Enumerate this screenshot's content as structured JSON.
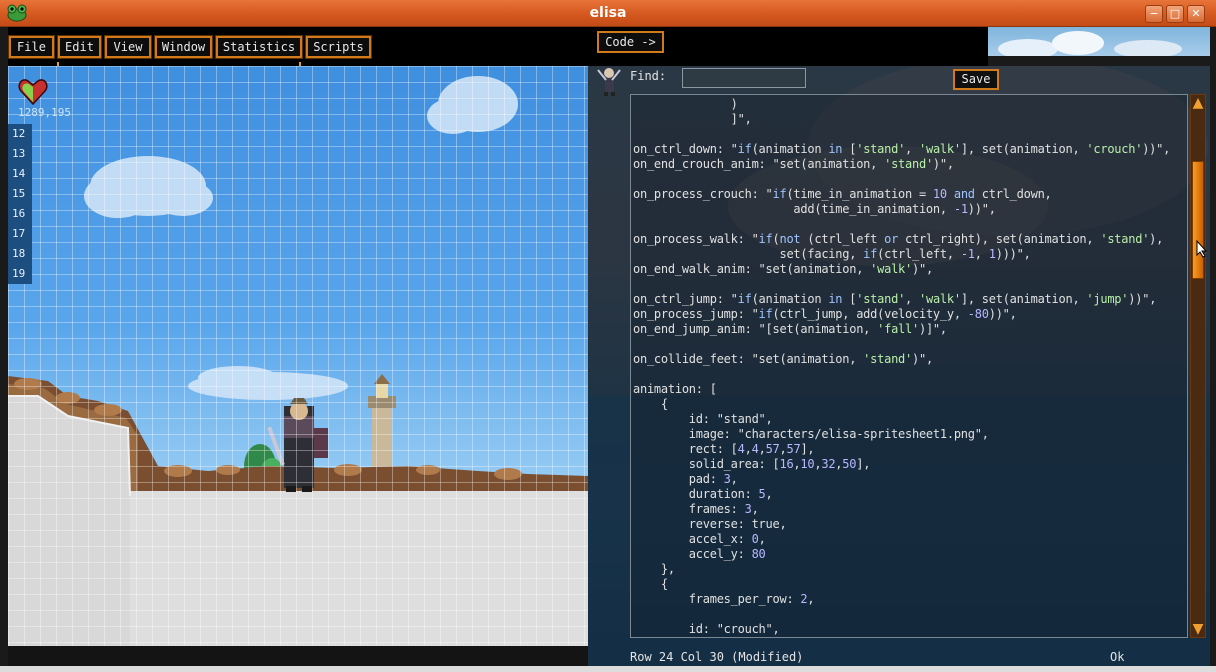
{
  "window": {
    "title": "elisa",
    "controls": {
      "minimize": "−",
      "maximize": "□",
      "close": "✕"
    }
  },
  "menu": {
    "items": [
      "File",
      "Edit",
      "View",
      "Window",
      "Statistics",
      "Scripts"
    ]
  },
  "code_button": "Code ->",
  "game": {
    "coords": "1289,195",
    "line_numbers": [
      "12",
      "13",
      "14",
      "15",
      "16",
      "17",
      "18",
      "19"
    ]
  },
  "editor": {
    "find_label": "Find:",
    "find_value": "",
    "save_label": "Save",
    "lines": [
      "              )",
      "              ]\",",
      "",
      "on_ctrl_down: \"if(animation in ['stand', 'walk'], set(animation, 'crouch'))\",",
      "on_end_crouch_anim: \"set(animation, 'stand')\",",
      "",
      "on_process_crouch: \"if(time_in_animation = 10 and ctrl_down,",
      "                       add(time_in_animation, -1))\",",
      "",
      "on_process_walk: \"if(not (ctrl_left or ctrl_right), set(animation, 'stand'),",
      "                     set(facing, if(ctrl_left, -1, 1)))\",",
      "on_end_walk_anim: \"set(animation, 'walk')\",",
      "",
      "on_ctrl_jump: \"if(animation in ['stand', 'walk'], set(animation, 'jump'))\",",
      "on_process_jump: \"if(ctrl_jump, add(velocity_y, -80))\",",
      "on_end_jump_anim: \"[set(animation, 'fall')]\",",
      "",
      "on_collide_feet: \"set(animation, 'stand')\",",
      "",
      "animation: [",
      "    {",
      "        id: \"stand\",",
      "        image: \"characters/elisa-spritesheet1.png\",",
      "        rect: [4,4,57,57],",
      "        solid_area: [16,10,32,50],",
      "        pad: 3,",
      "        duration: 5,",
      "        frames: 3,",
      "        reverse: true,",
      "        accel_x: 0,",
      "        accel_y: 80",
      "    },",
      "    {",
      "        frames_per_row: 2,",
      "",
      "        id: \"crouch\","
    ]
  },
  "status": {
    "position": "Row 24 Col 30 (Modified)",
    "result": "Ok"
  },
  "colors": {
    "accent": "#d17a1c",
    "title_bar": "#d4581f",
    "sky": "#5aa6ec"
  }
}
